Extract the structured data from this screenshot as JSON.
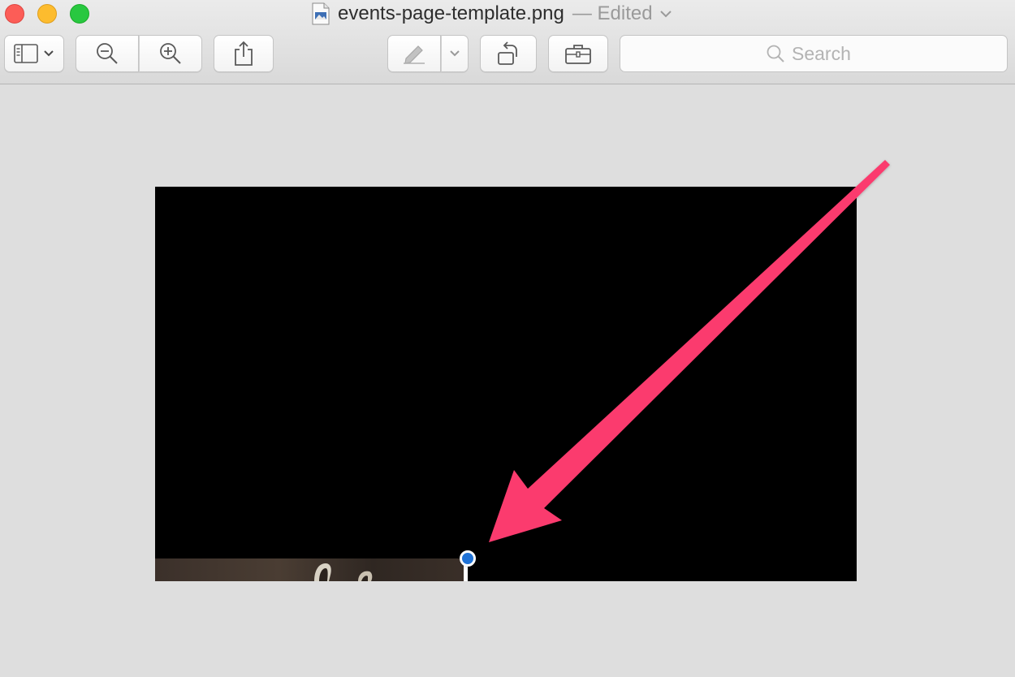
{
  "window": {
    "title_file": "events-page-template.png",
    "title_status": "— Edited"
  },
  "toolbar": {
    "sidebar_icon": "sidebar-icon",
    "zoom_out_icon": "zoom-out-icon",
    "zoom_in_icon": "zoom-in-icon",
    "share_icon": "share-icon",
    "markup_icon": "markup-pen-icon",
    "rotate_icon": "rotate-left-icon",
    "toolbox_icon": "toolbox-icon"
  },
  "search": {
    "placeholder": "Search"
  },
  "annotation": {
    "arrow_color": "#fb3a6e",
    "handle_color": "#1f72d6"
  }
}
